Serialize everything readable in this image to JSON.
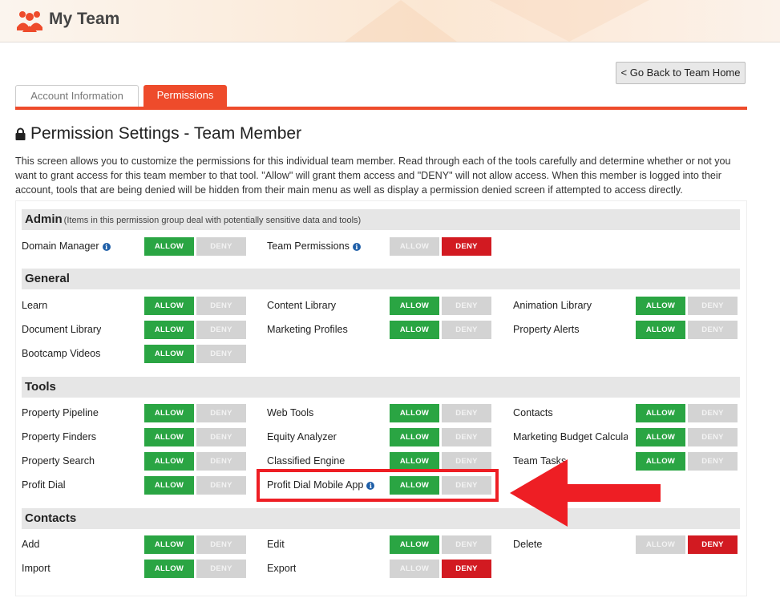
{
  "app": {
    "title": "My Team"
  },
  "nav": {
    "back_label": "< Go Back to Team Home"
  },
  "tabs": [
    {
      "label": "Account Information",
      "active": false
    },
    {
      "label": "Permissions",
      "active": true
    }
  ],
  "page": {
    "title": "Permission Settings - Team Member",
    "description": "This screen allows you to customize the permissions for this individual team member. Read through each of the tools carefully and determine whether or not you want to grant access for this team member to that tool. \"Allow\" will grant them access and \"DENY\" will not allow access. When this member is logged into their account, tools that are being denied will be hidden from their main menu as well as display a permission denied screen if attempted to access directly."
  },
  "buttons": {
    "allow": "ALLOW",
    "deny": "DENY"
  },
  "groups": [
    {
      "name": "Admin",
      "note": "(Items in this permission group deal with potentially sensitive data and tools)",
      "items": [
        {
          "label": "Domain Manager",
          "info": true,
          "state": "allow"
        },
        {
          "label": "Team Permissions",
          "info": true,
          "state": "deny"
        }
      ]
    },
    {
      "name": "General",
      "note": "",
      "items": [
        {
          "label": "Learn",
          "info": false,
          "state": "allow"
        },
        {
          "label": "Content Library",
          "info": false,
          "state": "allow"
        },
        {
          "label": "Animation Library",
          "info": false,
          "state": "allow"
        },
        {
          "label": "Document Library",
          "info": false,
          "state": "allow"
        },
        {
          "label": "Marketing Profiles",
          "info": false,
          "state": "allow"
        },
        {
          "label": "Property Alerts",
          "info": false,
          "state": "allow"
        },
        {
          "label": "Bootcamp Videos",
          "info": false,
          "state": "allow"
        }
      ]
    },
    {
      "name": "Tools",
      "note": "",
      "items": [
        {
          "label": "Property Pipeline",
          "info": false,
          "state": "allow"
        },
        {
          "label": "Web Tools",
          "info": false,
          "state": "allow"
        },
        {
          "label": "Contacts",
          "info": false,
          "state": "allow"
        },
        {
          "label": "Property Finders",
          "info": false,
          "state": "allow"
        },
        {
          "label": "Equity Analyzer",
          "info": false,
          "state": "allow"
        },
        {
          "label": "Marketing Budget Calcula",
          "info": false,
          "state": "allow"
        },
        {
          "label": "Property Search",
          "info": false,
          "state": "allow"
        },
        {
          "label": "Classified Engine",
          "info": false,
          "state": "allow"
        },
        {
          "label": "Team Tasks",
          "info": false,
          "state": "allow"
        },
        {
          "label": "Profit Dial",
          "info": false,
          "state": "allow"
        },
        {
          "label": "Profit Dial Mobile App",
          "info": true,
          "state": "allow"
        }
      ]
    },
    {
      "name": "Contacts",
      "note": "",
      "items": [
        {
          "label": "Add",
          "info": false,
          "state": "allow"
        },
        {
          "label": "Edit",
          "info": false,
          "state": "allow"
        },
        {
          "label": "Delete",
          "info": false,
          "state": "deny"
        },
        {
          "label": "Import",
          "info": false,
          "state": "allow"
        },
        {
          "label": "Export",
          "info": false,
          "state": "deny"
        }
      ]
    }
  ],
  "colors": {
    "accent": "#ee4b2b",
    "allow": "#2aa543",
    "deny": "#d21a21",
    "inactive": "#d3d3d3",
    "callout": "#ee1e24"
  }
}
